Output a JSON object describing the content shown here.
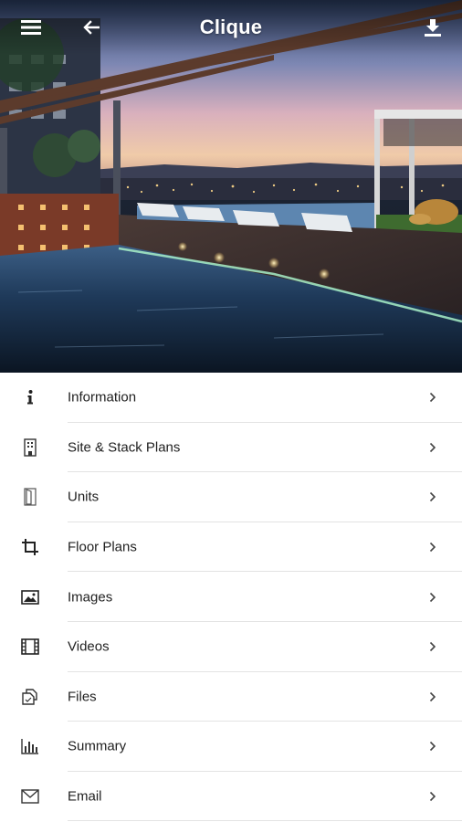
{
  "app_bar": {
    "title": "Clique",
    "menu_icon": "hamburger-menu-icon",
    "back_icon": "arrow-back-icon",
    "download_icon": "download-icon",
    "text_color": "#ffffff"
  },
  "hero": {
    "scene": "rooftop-infinity-pool-at-dusk"
  },
  "menu": {
    "label_color": "#212121",
    "divider_color": "#e3e3e3",
    "chevron_icon": "chevron-right-icon",
    "items": [
      {
        "label": "Information",
        "icon": "info-icon"
      },
      {
        "label": "Site & Stack Plans",
        "icon": "building-icon"
      },
      {
        "label": "Units",
        "icon": "door-icon"
      },
      {
        "label": "Floor Plans",
        "icon": "crop-icon"
      },
      {
        "label": "Images",
        "icon": "image-icon"
      },
      {
        "label": "Videos",
        "icon": "film-icon"
      },
      {
        "label": "Files",
        "icon": "files-icon"
      },
      {
        "label": "Summary",
        "icon": "bar-chart-icon"
      },
      {
        "label": "Email",
        "icon": "mail-icon"
      }
    ]
  }
}
